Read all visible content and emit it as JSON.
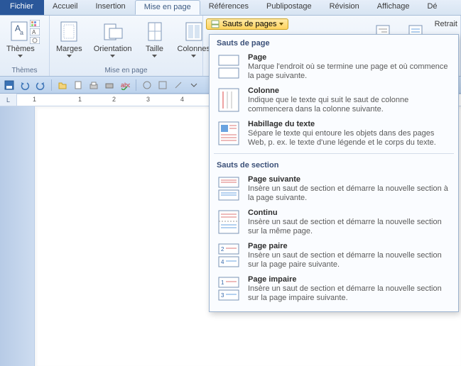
{
  "tabs": {
    "file": "Fichier",
    "home": "Accueil",
    "insert": "Insertion",
    "layout": "Mise en page",
    "references": "Références",
    "mailings": "Publipostage",
    "review": "Révision",
    "view": "Affichage",
    "dev": "Dé"
  },
  "ribbon": {
    "themes": {
      "label": "Thèmes",
      "button": "Thèmes"
    },
    "page_setup": {
      "label": "Mise en page",
      "margins": "Marges",
      "orientation": "Orientation",
      "size": "Taille",
      "columns": "Colonnes"
    },
    "breaks_button": "Sauts de pages",
    "retrait": "Retrait"
  },
  "ruler": {
    "marks": [
      "1",
      "",
      "1",
      "2",
      "3",
      "4",
      "",
      "",
      "",
      ""
    ],
    "corner": "L"
  },
  "dropdown": {
    "section1": "Sauts de page",
    "section2": "Sauts de section",
    "items1": [
      {
        "title": "Page",
        "desc": "Marque l'endroit où se termine une page et où commence la page suivante."
      },
      {
        "title": "Colonne",
        "desc": "Indique que le texte qui suit le saut de colonne commencera dans la colonne suivante."
      },
      {
        "title": "Habillage du texte",
        "desc": "Sépare le texte qui entoure les objets dans des pages Web, p. ex. le texte d'une légende et le corps du texte."
      }
    ],
    "items2": [
      {
        "title": "Page suivante",
        "desc": "Insère un saut de section et démarre la nouvelle section à la page suivante."
      },
      {
        "title": "Continu",
        "desc": "Insère un saut de section et démarre la nouvelle section sur la même page."
      },
      {
        "title": "Page paire",
        "desc": "Insère un saut de section et démarre la nouvelle section sur la page paire suivante."
      },
      {
        "title": "Page impaire",
        "desc": "Insère un saut de section et démarre la nouvelle section sur la page impaire suivante."
      }
    ]
  }
}
